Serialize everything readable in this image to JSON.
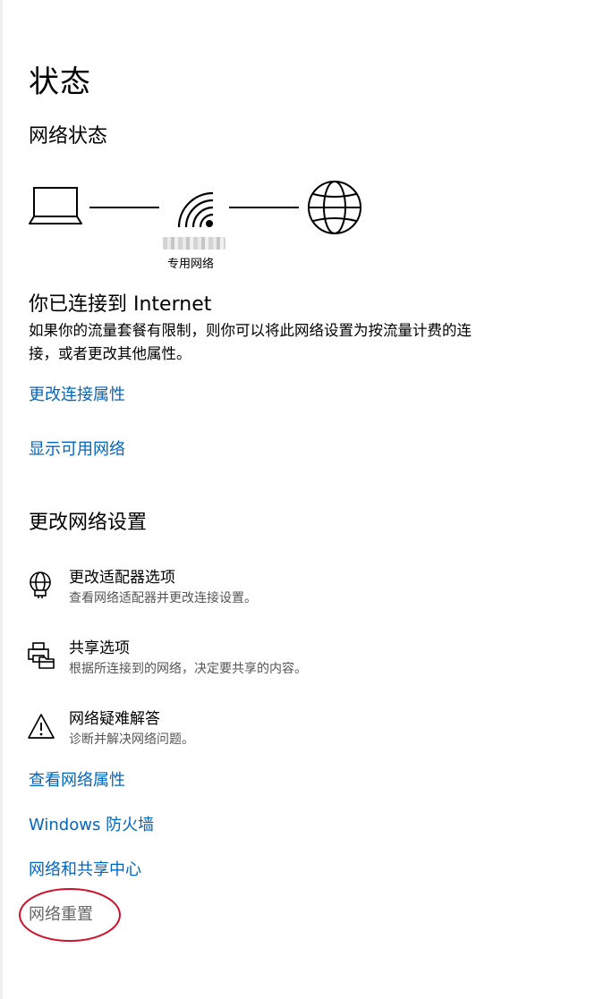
{
  "page": {
    "title": "状态",
    "network_status_heading": "网络状态"
  },
  "diagram": {
    "device_icon": "laptop-icon",
    "network_icon": "wifi-icon",
    "internet_icon": "globe-icon",
    "network_type": "专用网络"
  },
  "connection": {
    "title": "你已连接到 Internet",
    "description": "如果你的流量套餐有限制，则你可以将此网络设置为按流量计费的连接，或者更改其他属性。",
    "change_properties_link": "更改连接属性",
    "show_networks_link": "显示可用网络"
  },
  "change_settings": {
    "heading": "更改网络设置",
    "items": [
      {
        "icon": "adapter-globe-icon",
        "title": "更改适配器选项",
        "subtitle": "查看网络适配器并更改连接设置。"
      },
      {
        "icon": "sharing-printer-icon",
        "title": "共享选项",
        "subtitle": "根据所连接到的网络，决定要共享的内容。"
      },
      {
        "icon": "warning-triangle-icon",
        "title": "网络疑难解答",
        "subtitle": "诊断并解决网络问题。"
      }
    ]
  },
  "links": {
    "view_properties": "查看网络属性",
    "firewall": "Windows 防火墙",
    "sharing_center": "网络和共享中心",
    "reset": "网络重置"
  },
  "colors": {
    "link": "#0067c0",
    "annotation": "#d0112b"
  }
}
